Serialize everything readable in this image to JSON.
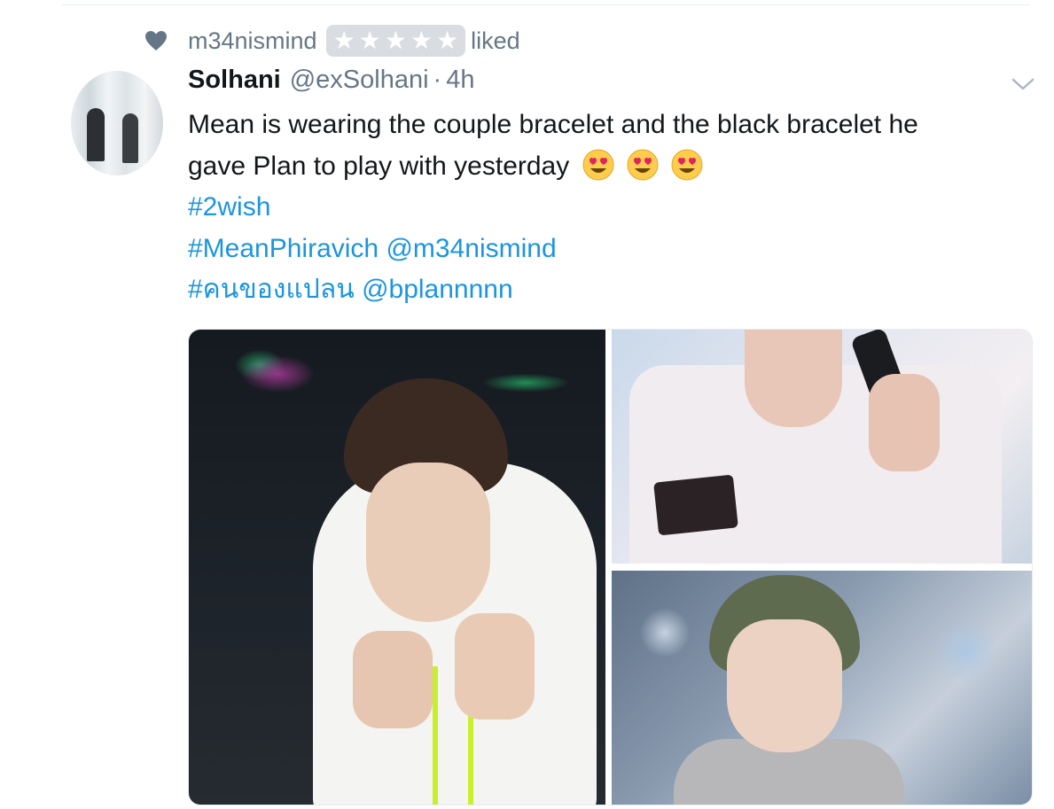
{
  "social_context": {
    "icon": "heart-icon",
    "username": "m34nismind",
    "stars": [
      "★",
      "★",
      "★",
      "★",
      "★"
    ],
    "action": "liked"
  },
  "tweet": {
    "author": {
      "display_name": "Solhani",
      "handle": "@exSolhani",
      "separator": "·",
      "time": "4h"
    },
    "text_line_1": "Mean is wearing the couple bracelet and the black bracelet he",
    "text_line_2": "gave Plan to play with yesterday",
    "emojis": [
      "heart-eyes-emoji",
      "heart-eyes-emoji",
      "heart-eyes-emoji"
    ],
    "hashtag_1": "#2wish",
    "hashtag_2": "#MeanPhiravich",
    "mention_1": "@m34nismind",
    "hashtag_3": "#คนของแปลน",
    "mention_2": "@bplannnnn",
    "menu_icon": "chevron-down-icon"
  },
  "media": {
    "photos": [
      {
        "name": "photo-hoodie-portrait"
      },
      {
        "name": "photo-microphone-bracelet"
      },
      {
        "name": "photo-green-hair-portrait"
      }
    ]
  },
  "colors": {
    "link": "#1b95e0",
    "secondary_text": "#657786",
    "primary_text": "#14171a",
    "divider": "#e6ecf0",
    "stars_bg": "#d9dde1"
  }
}
